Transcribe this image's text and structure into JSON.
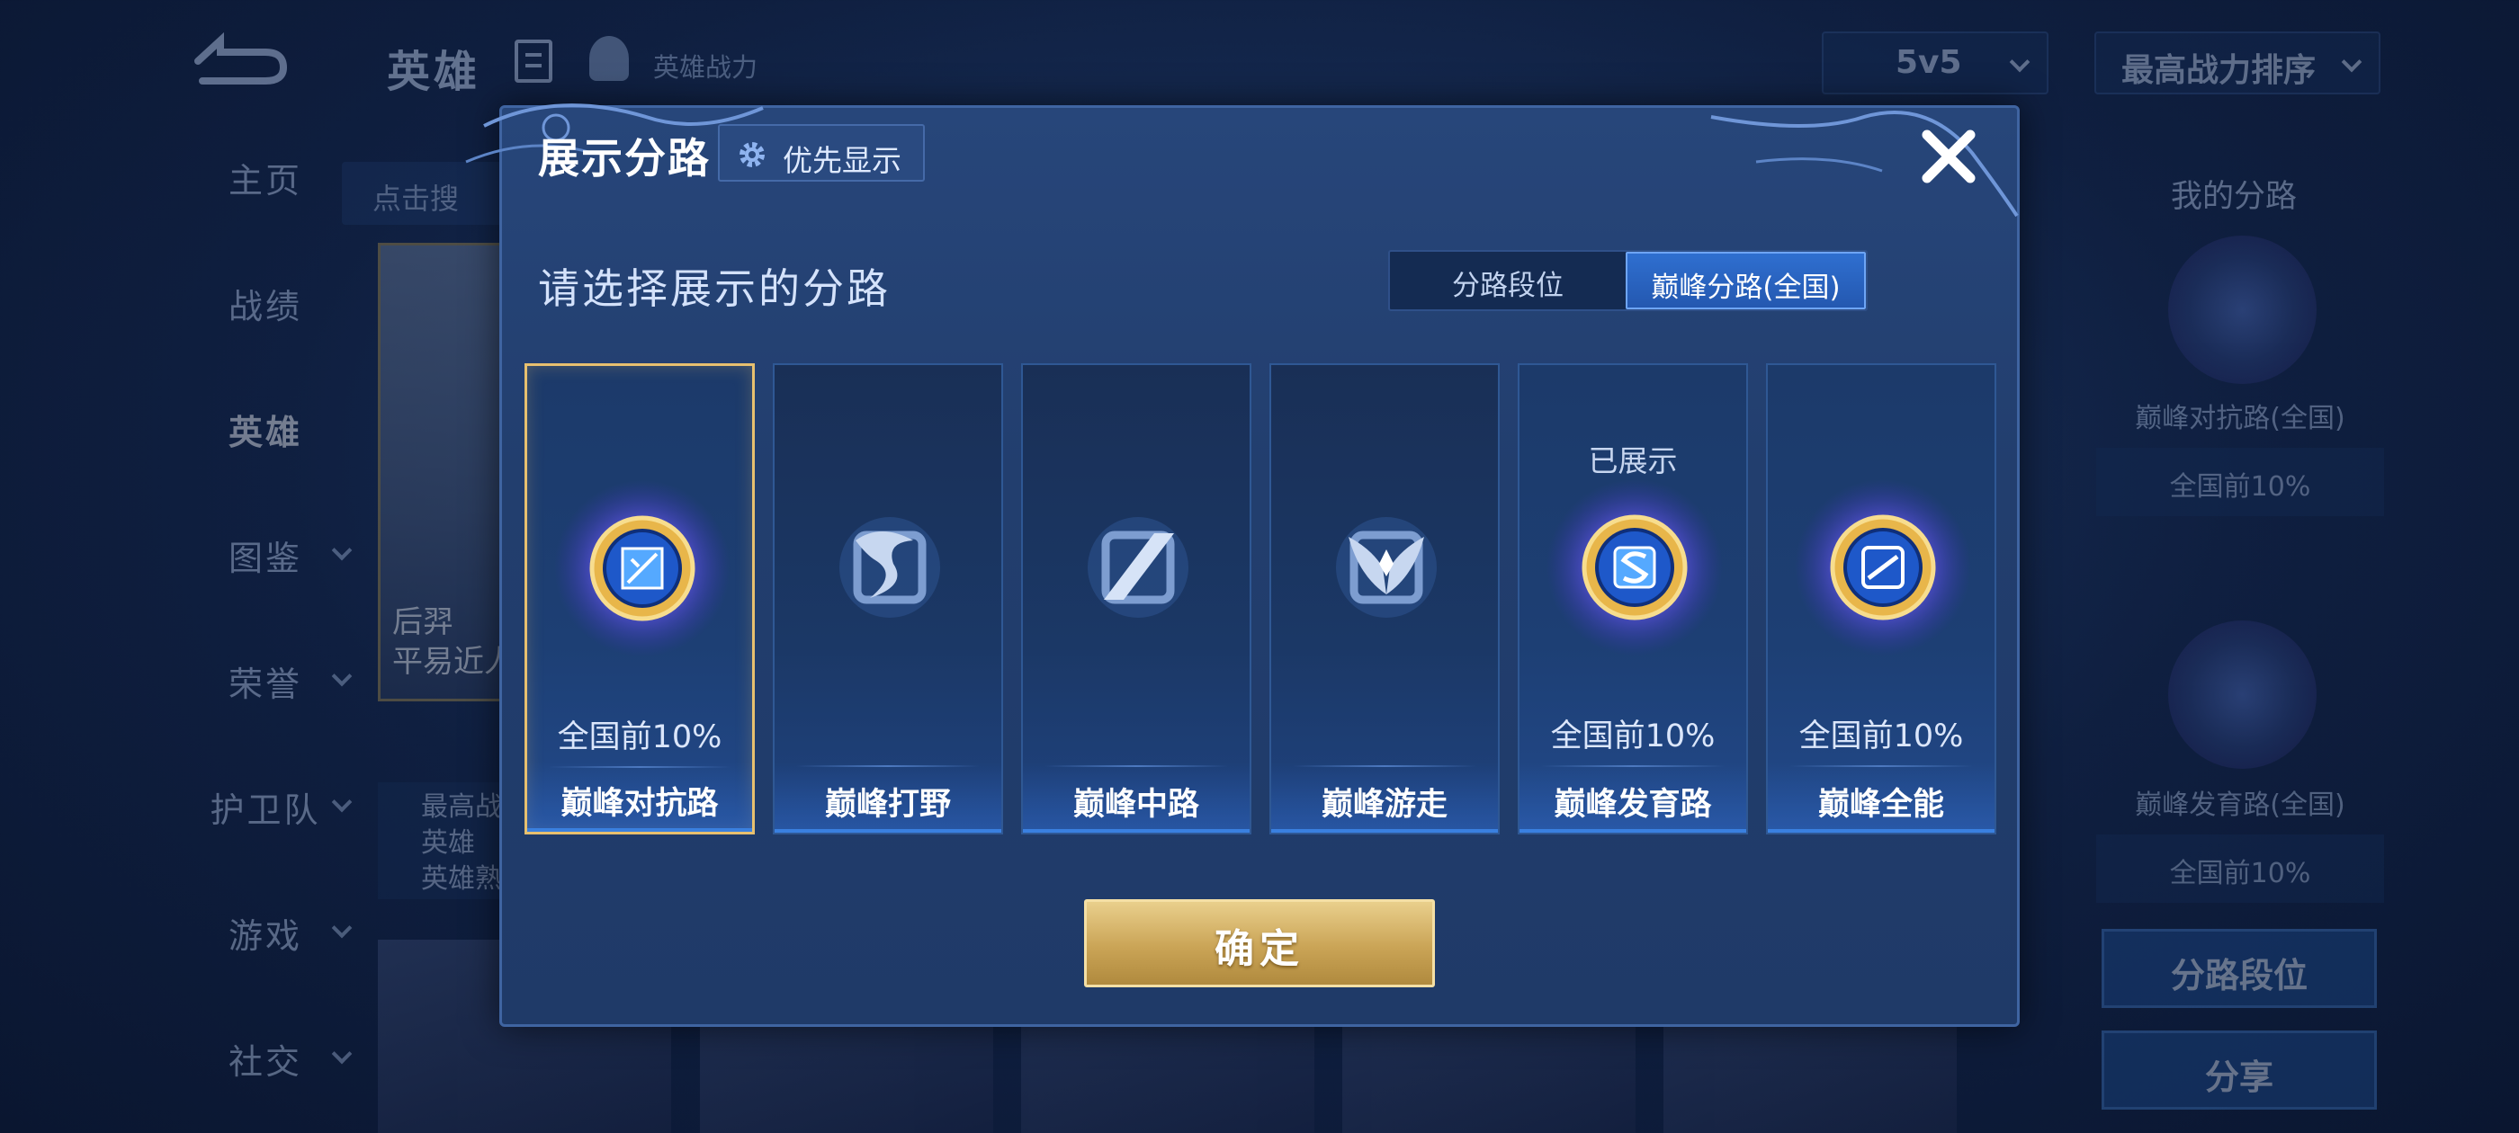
{
  "background": {
    "title": "英雄",
    "hero_power_label": "英雄战力",
    "mode_select": "5v5",
    "sort_select": "最高战力排序",
    "nav": [
      "主页",
      "战绩",
      "英雄",
      "图鉴",
      "荣誉",
      "护卫队",
      "游戏",
      "社交"
    ],
    "search_placeholder": "点击搜",
    "hero_card": {
      "name_line1": "后羿",
      "name_line2": "平易近人"
    },
    "hero_stats": [
      "最高战",
      "英雄",
      "英雄熟"
    ],
    "right_panel": {
      "title": "我的分路",
      "badge1_label": "巅峰对抗路(全国)",
      "badge1_rank": "全国前10%",
      "badge2_label": "巅峰发育路(全国)",
      "badge2_rank": "全国前10%",
      "lane_rank_button": "分路段位",
      "share_button": "分享"
    }
  },
  "modal": {
    "title": "展示分路",
    "priority_button": "优先显示",
    "subtitle": "请选择展示的分路",
    "tabs": [
      {
        "label": "分路段位",
        "active": false
      },
      {
        "label": "巅峰分路(全国)",
        "active": true
      }
    ],
    "lanes": [
      {
        "name": "巅峰对抗路",
        "rank": "全国前10%",
        "shown": "",
        "selected": true,
        "icon": "clash-lane-icon"
      },
      {
        "name": "巅峰打野",
        "rank": "",
        "shown": "",
        "selected": false,
        "icon": "jungle-icon"
      },
      {
        "name": "巅峰中路",
        "rank": "",
        "shown": "",
        "selected": false,
        "icon": "mid-lane-icon"
      },
      {
        "name": "巅峰游走",
        "rank": "",
        "shown": "",
        "selected": false,
        "icon": "roam-icon"
      },
      {
        "name": "巅峰发育路",
        "rank": "全国前10%",
        "shown": "已展示",
        "selected": false,
        "icon": "farm-lane-icon"
      },
      {
        "name": "巅峰全能",
        "rank": "全国前10%",
        "shown": "",
        "selected": false,
        "icon": "all-round-icon"
      }
    ],
    "confirm_button": "确定"
  },
  "colors": {
    "accent_gold": "#e7c06f",
    "tab_active": "#2f6fd0",
    "panel_bg": "#223e6e"
  }
}
